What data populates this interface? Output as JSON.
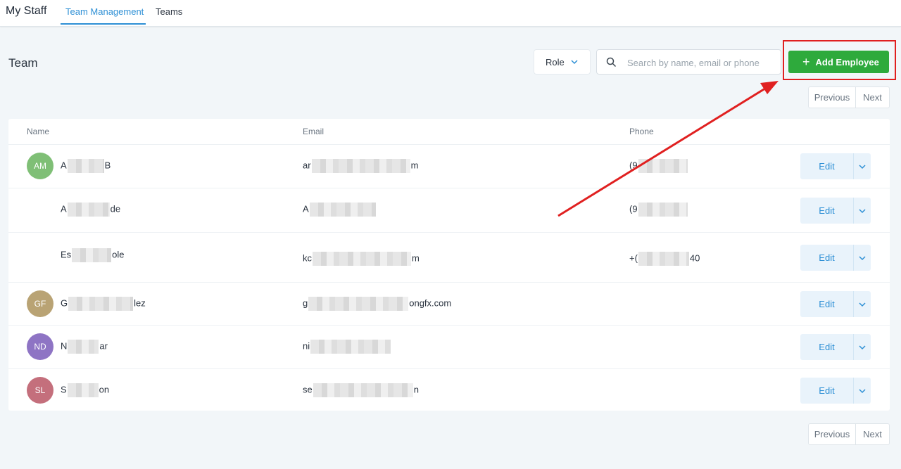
{
  "header": {
    "app_title": "My Staff",
    "tabs": [
      {
        "label": "Team Management",
        "active": true
      },
      {
        "label": "Teams",
        "active": false
      }
    ]
  },
  "page": {
    "title": "Team",
    "role_filter_label": "Role",
    "search_placeholder": "Search by name, email or phone",
    "search_value": "",
    "add_button_label": "Add Employee"
  },
  "pagination": {
    "previous_label": "Previous",
    "next_label": "Next"
  },
  "table": {
    "columns": {
      "name": "Name",
      "email": "Email",
      "phone": "Phone"
    },
    "rows": [
      {
        "initials": "AM",
        "avatar_color": "#7fbf76",
        "name_start": "A",
        "name_end": "B",
        "email_start": "ar",
        "email_end": "m",
        "phone_start": "(9",
        "phone_end": "",
        "edit_label": "Edit"
      },
      {
        "initials": "",
        "avatar_color": "",
        "name_start": "A",
        "name_end": "de",
        "email_start": "A",
        "email_end": "",
        "phone_start": "(9",
        "phone_end": "",
        "edit_label": "Edit"
      },
      {
        "initials": "",
        "avatar_color": "",
        "name_start": "Es",
        "name_end": "ole",
        "email_start": "kc",
        "email_end": "m",
        "phone_start": "+(",
        "phone_end": "40",
        "edit_label": "Edit"
      },
      {
        "initials": "GF",
        "avatar_color": "#b9a374",
        "name_start": "G",
        "name_end": "lez",
        "email_start": "g",
        "email_end": "ongfx.com",
        "phone_start": "",
        "phone_end": "",
        "edit_label": "Edit"
      },
      {
        "initials": "ND",
        "avatar_color": "#8e74c4",
        "name_start": "N",
        "name_end": "ar",
        "email_start": "ni",
        "email_end": "",
        "phone_start": "",
        "phone_end": "",
        "edit_label": "Edit"
      },
      {
        "initials": "SL",
        "avatar_color": "#c46f7c",
        "name_start": "S",
        "name_end": "on",
        "email_start": "se",
        "email_end": "n",
        "phone_start": "",
        "phone_end": "",
        "edit_label": "Edit"
      }
    ]
  },
  "colors": {
    "accent": "#2d8fd5",
    "primary_button": "#2eaa3c",
    "annotation": "#e02020"
  },
  "icons": {
    "search": "search-icon",
    "role_dropdown": "chevron-down-icon",
    "add": "plus-icon",
    "row_menu": "chevron-down-icon"
  }
}
